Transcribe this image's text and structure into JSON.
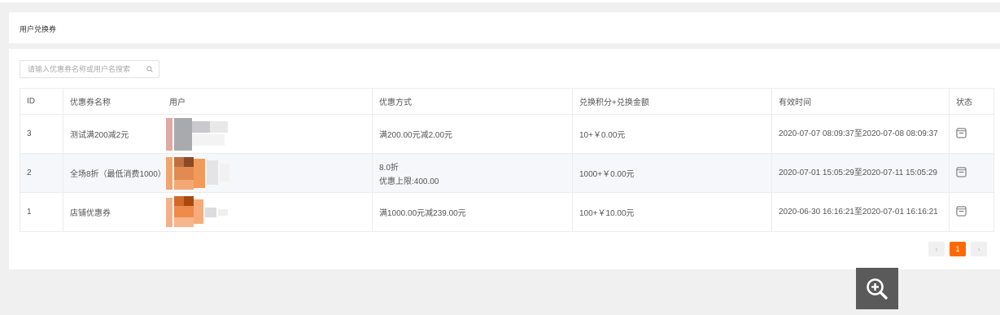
{
  "header": {
    "title": "用户兑换券"
  },
  "search": {
    "placeholder": "请输入优惠券名称或用户名搜索",
    "icon": "search-icon"
  },
  "table": {
    "columns": [
      "ID",
      "优惠券名称",
      "用户",
      "优惠方式",
      "兑换积分+兑换金额",
      "有效时间",
      "状态"
    ],
    "rows": [
      {
        "id": "3",
        "name": "测试满200减2元",
        "user": "",
        "discount_line1": "满200.00元减2.00元",
        "discount_line2": "",
        "points": "10+￥0.00元",
        "valid": "2020-07-07 08:09:37至2020-07-08 08:09:37",
        "status_icon": "minus-square-icon"
      },
      {
        "id": "2",
        "name": "全场8折（最低消费1000）",
        "user": "",
        "discount_line1": "8.0折",
        "discount_line2": "优惠上限:400.00",
        "points": "1000+￥0.00元",
        "valid": "2020-07-01 15:05:29至2020-07-11 15:05:29",
        "status_icon": "minus-square-icon"
      },
      {
        "id": "1",
        "name": "店铺优惠券",
        "user": "",
        "discount_line1": "满1000.00元减239.00元",
        "discount_line2": "",
        "points": "100+￥10.00元",
        "valid": "2020-06-30 16:16:21至2020-07-01 16:16:21",
        "status_icon": "minus-square-icon"
      }
    ]
  },
  "pagination": {
    "prev": "‹",
    "current": "1",
    "next": "›"
  },
  "zoom": {
    "icon": "zoom-in-icon"
  },
  "colors": {
    "accent": "#ff6a00",
    "alt_row": "#f6f7fa",
    "zoom_bg": "#5a5a5a"
  }
}
